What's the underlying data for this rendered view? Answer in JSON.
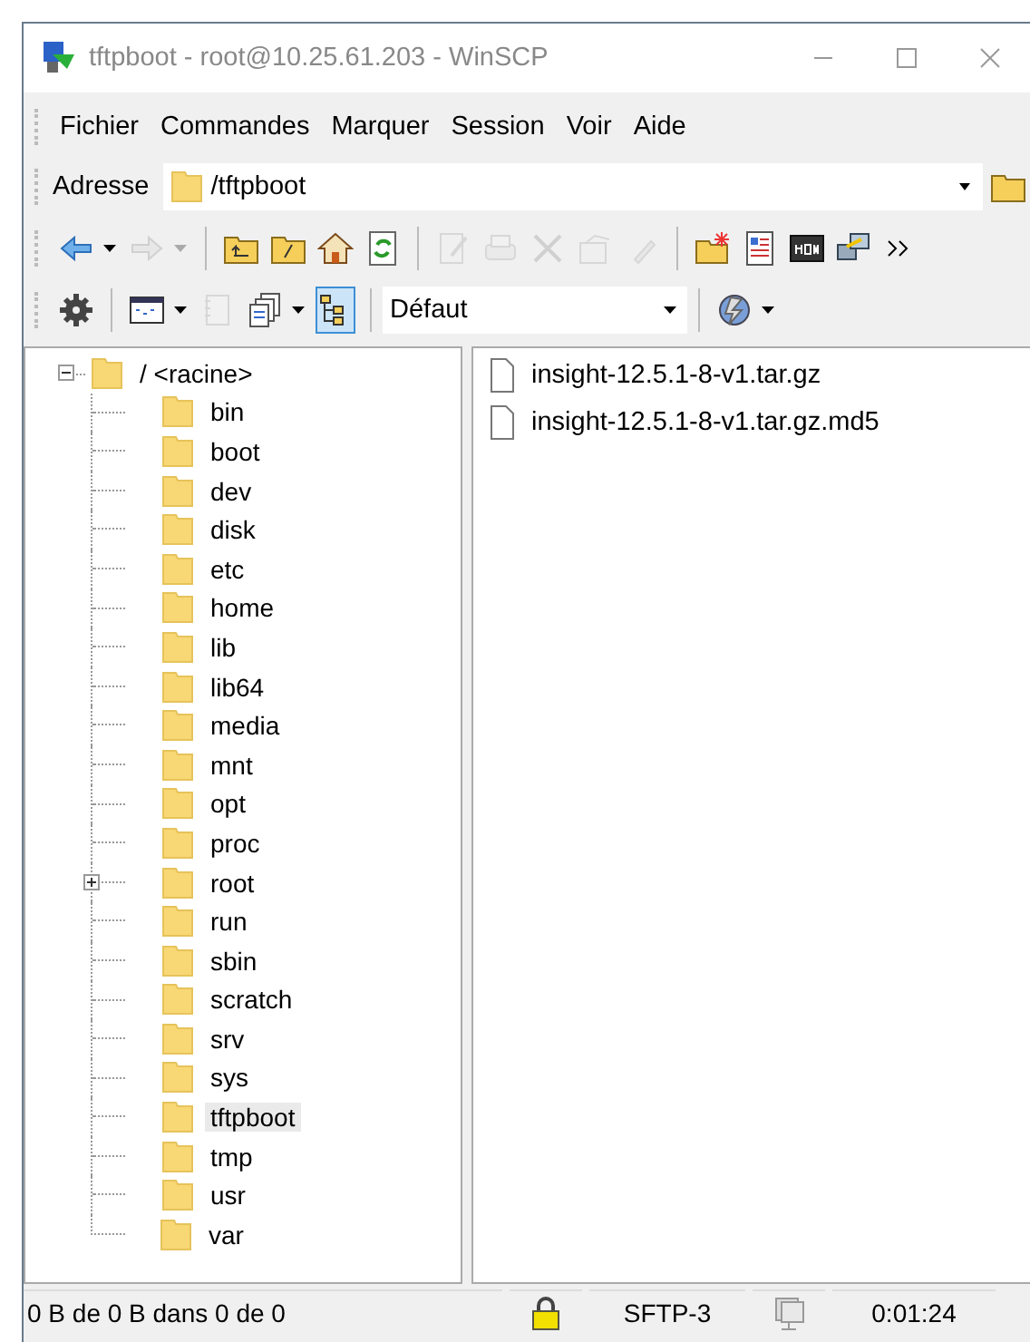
{
  "window": {
    "title": "tftpboot - root@10.25.61.203 - WinSCP"
  },
  "menu": [
    "Fichier",
    "Commandes",
    "Marquer",
    "Session",
    "Voir",
    "Aide"
  ],
  "address": {
    "label": "Adresse",
    "value": "/tftpboot"
  },
  "toolbar": [
    {
      "kind": "button",
      "disabled": false
    },
    {
      "kind": "dropdown",
      "disabled": false
    },
    {
      "kind": "button",
      "disabled": true
    },
    {
      "kind": "dropdown",
      "disabled": true
    },
    {
      "kind": "separator"
    },
    {
      "kind": "button",
      "disabled": false
    },
    {
      "kind": "button",
      "disabled": false
    },
    {
      "kind": "button",
      "disabled": false
    },
    {
      "kind": "button",
      "disabled": false
    },
    {
      "kind": "separator"
    },
    {
      "kind": "button",
      "disabled": true
    },
    {
      "kind": "button",
      "disabled": true
    },
    {
      "kind": "button",
      "disabled": true
    },
    {
      "kind": "button",
      "disabled": true
    },
    {
      "kind": "button",
      "disabled": true
    },
    {
      "kind": "separator"
    },
    {
      "kind": "button",
      "disabled": false
    },
    {
      "kind": "button",
      "disabled": false
    },
    {
      "kind": "button",
      "disabled": false
    },
    {
      "kind": "button",
      "disabled": false
    },
    {
      "kind": "button",
      "disabled": false
    }
  ],
  "toolbar_2": [
    {
      "kind": "button",
      "disabled": false
    },
    {
      "kind": "separator"
    },
    {
      "kind": "button",
      "disabled": false
    },
    {
      "kind": "dropdown",
      "disabled": false
    },
    {
      "kind": "button",
      "disabled": true
    },
    {
      "kind": "button",
      "disabled": false
    },
    {
      "kind": "dropdown",
      "disabled": false
    },
    {
      "kind": "button",
      "disabled": false,
      "selected": true
    },
    {
      "kind": "separator"
    },
    {
      "kind": "combo",
      "value": "Défaut"
    },
    {
      "kind": "separator"
    },
    {
      "kind": "button",
      "disabled": false
    },
    {
      "kind": "dropdown",
      "disabled": false
    }
  ],
  "tree": {
    "label": "/ <racine>",
    "expanded": true,
    "selected": false,
    "children": [
      {
        "label": "bin",
        "selected": false
      },
      {
        "label": "boot",
        "selected": false
      },
      {
        "label": "dev",
        "selected": false
      },
      {
        "label": "disk",
        "selected": false
      },
      {
        "label": "etc",
        "selected": false
      },
      {
        "label": "home",
        "selected": false
      },
      {
        "label": "lib",
        "selected": false
      },
      {
        "label": "lib64",
        "selected": false
      },
      {
        "label": "media",
        "selected": false
      },
      {
        "label": "mnt",
        "selected": false
      },
      {
        "label": "opt",
        "selected": false
      },
      {
        "label": "proc",
        "selected": false
      },
      {
        "label": "root",
        "selected": false,
        "expanded": false
      },
      {
        "label": "run",
        "selected": false
      },
      {
        "label": "sbin",
        "selected": false
      },
      {
        "label": "scratch",
        "selected": false
      },
      {
        "label": "srv",
        "selected": false
      },
      {
        "label": "sys",
        "selected": false
      },
      {
        "label": "tftpboot",
        "selected": true
      },
      {
        "label": "tmp",
        "selected": false
      },
      {
        "label": "usr",
        "selected": false
      },
      {
        "label": "var",
        "selected": false
      }
    ]
  },
  "files": [
    "insight-12.5.1-8-v1.tar.gz",
    "insight-12.5.1-8-v1.tar.gz.md5"
  ],
  "status_bar": [
    {
      "kind": "text",
      "text": "0 B de 0 B dans 0 de 0"
    },
    {
      "kind": "lock"
    },
    {
      "kind": "text",
      "text": "SFTP-3"
    },
    {
      "kind": "network"
    },
    {
      "kind": "text",
      "text": "0:01:24"
    }
  ]
}
